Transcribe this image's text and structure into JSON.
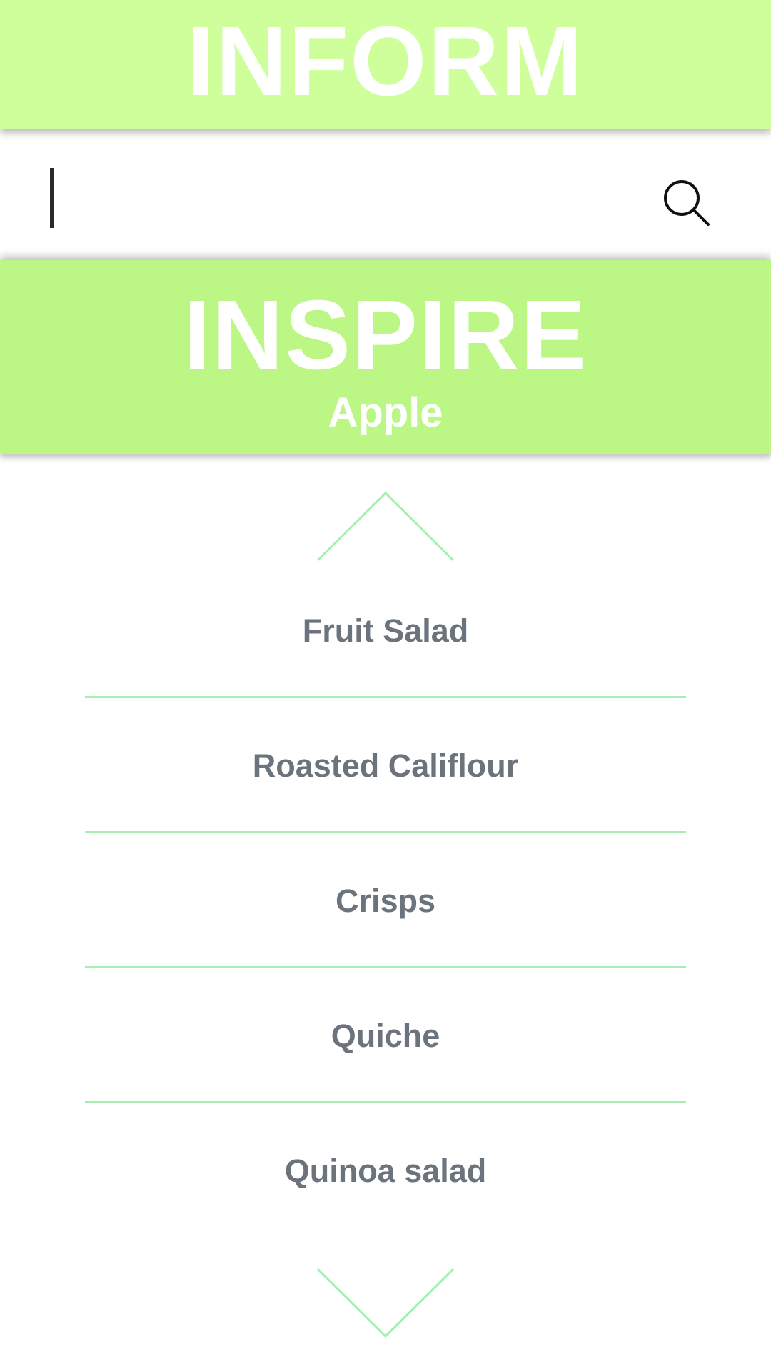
{
  "header": {
    "title": "INFORM"
  },
  "search": {
    "placeholder": "",
    "value": "",
    "icon": "search-icon"
  },
  "inspire": {
    "title": "INSPIRE",
    "subtitle": "Apple"
  },
  "picker": {
    "up_icon": "chevron-up-icon",
    "down_icon": "chevron-down-icon",
    "items": [
      {
        "label": "Fruit Salad"
      },
      {
        "label": "Roasted Califlour"
      },
      {
        "label": "Crisps"
      },
      {
        "label": "Quiche"
      },
      {
        "label": "Quinoa salad"
      }
    ]
  },
  "colors": {
    "header_bg": "#ceff9b",
    "inspire_bg": "#bcf786",
    "accent_line": "#a6efb3",
    "item_text": "#6b737d"
  }
}
